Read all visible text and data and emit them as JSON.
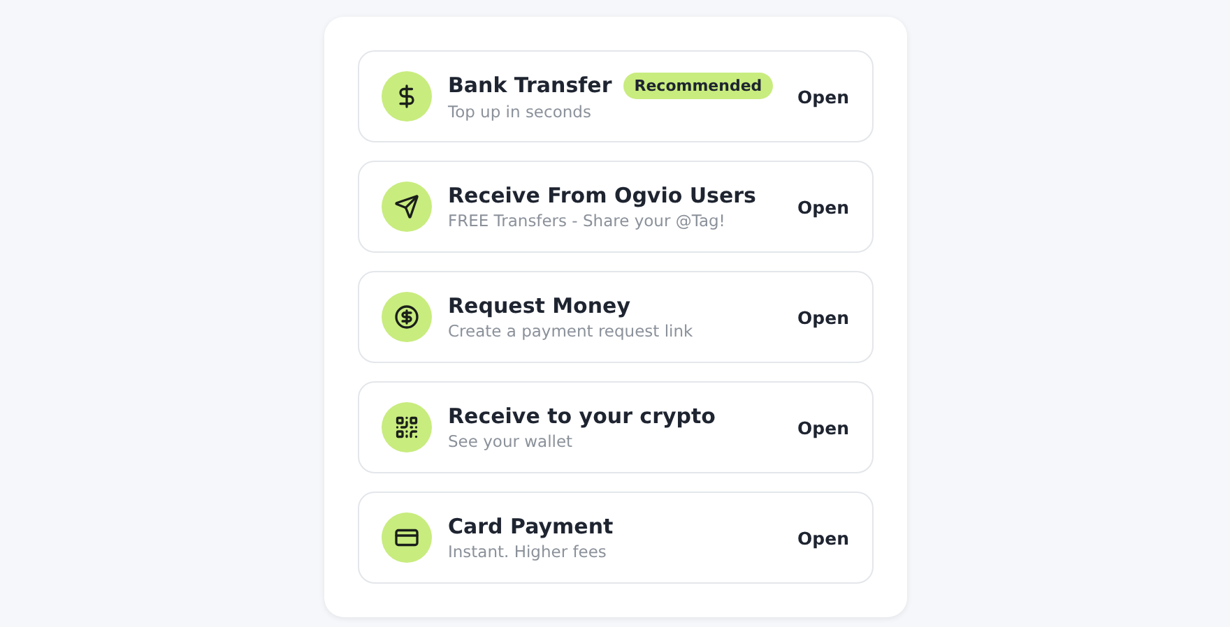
{
  "methods": [
    {
      "title": "Bank Transfer",
      "badge": "Recommended",
      "subtitle": "Top up in seconds",
      "action": "Open"
    },
    {
      "title": "Receive From Ogvio Users",
      "subtitle": "FREE Transfers - Share your @Tag!",
      "action": "Open"
    },
    {
      "title": "Request Money",
      "subtitle": "Create a payment request link",
      "action": "Open"
    },
    {
      "title": "Receive to your crypto",
      "subtitle": "See your wallet",
      "action": "Open"
    },
    {
      "title": "Card Payment",
      "subtitle": "Instant. Higher fees",
      "action": "Open"
    }
  ]
}
